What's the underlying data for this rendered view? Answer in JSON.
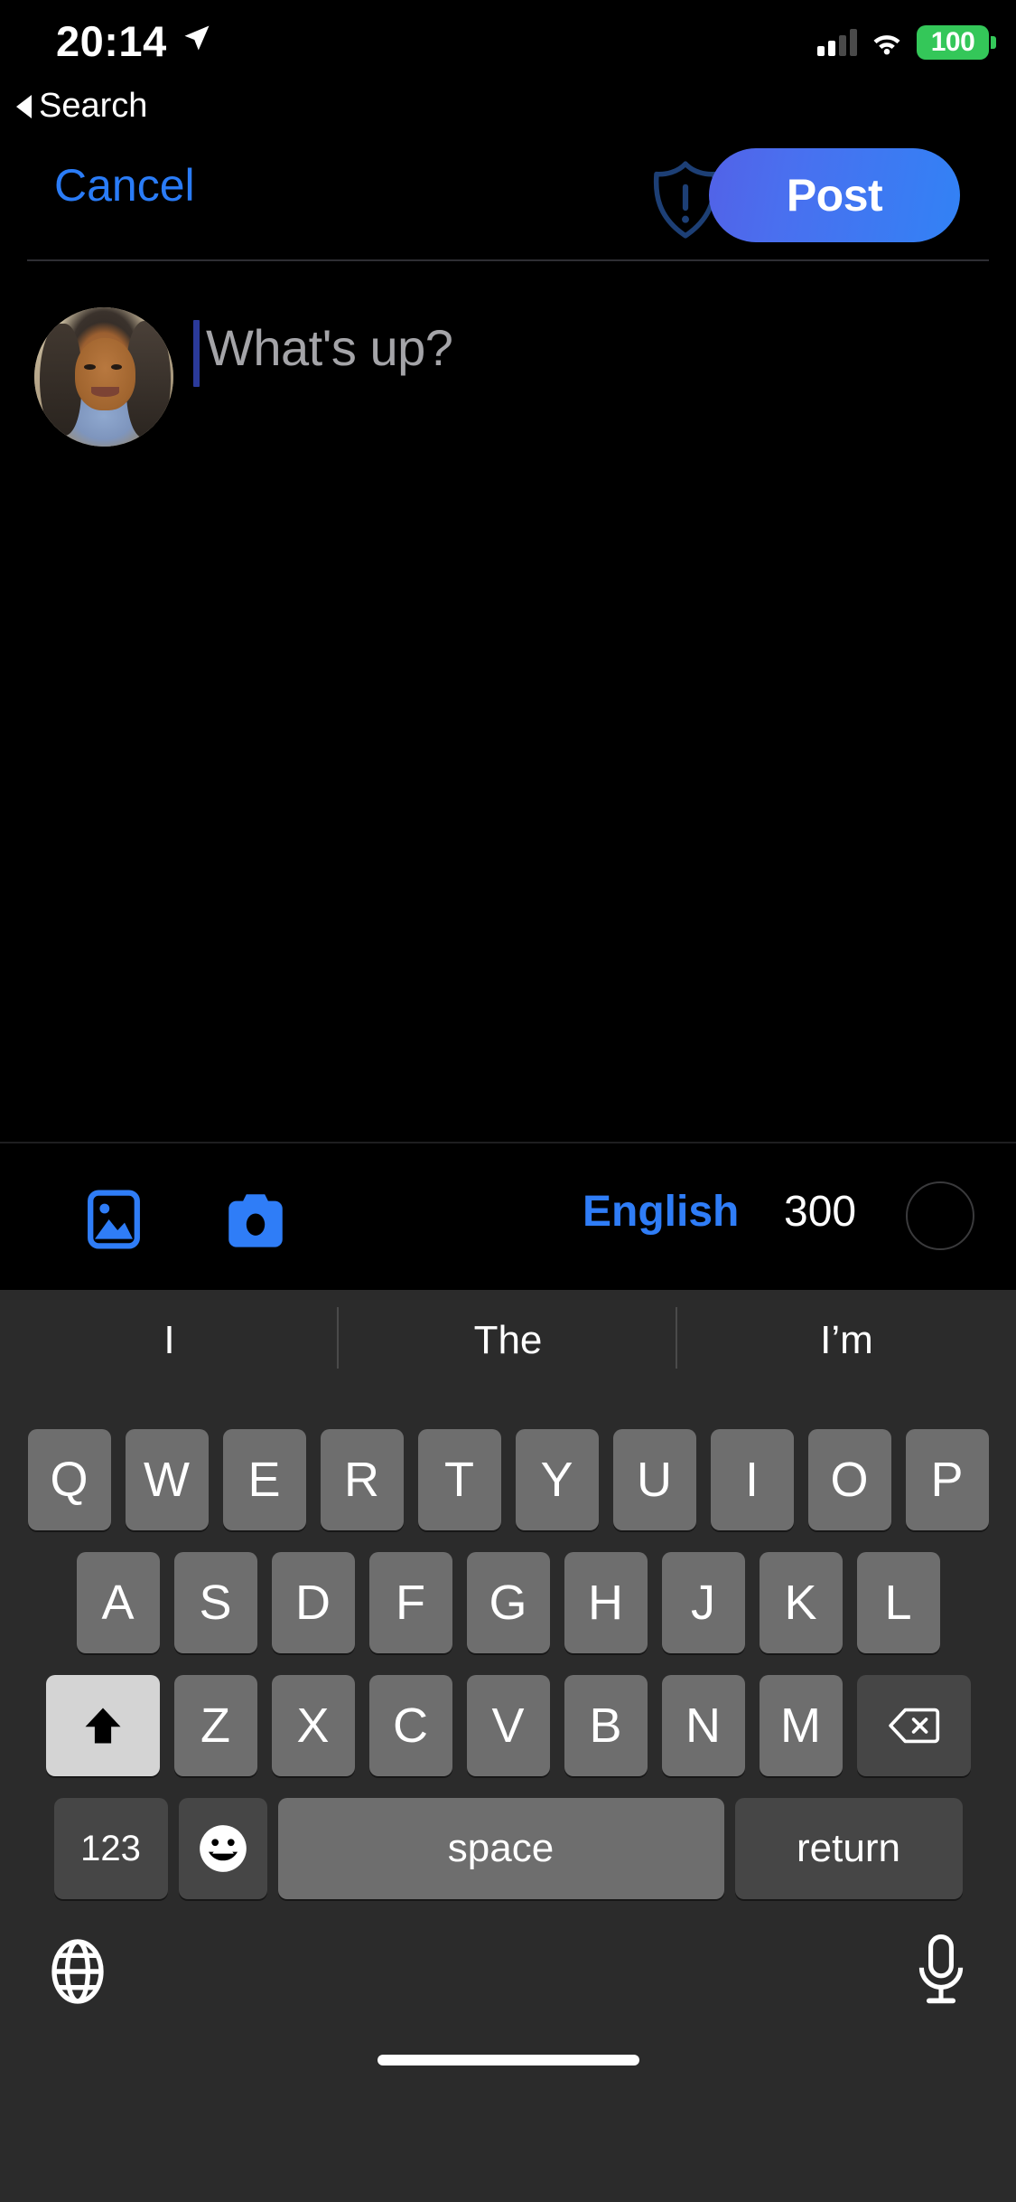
{
  "status_bar": {
    "time": "20:14",
    "location_icon": "location-arrow-icon",
    "signal_icon": "cellular-signal-icon",
    "wifi_icon": "wifi-icon",
    "battery_level": "100",
    "battery_color": "#34c759"
  },
  "back_to_app": {
    "label": "Search",
    "icon": "back-triangle-icon"
  },
  "nav": {
    "cancel_label": "Cancel",
    "shield_icon": "shield-exclamation-icon",
    "shield_color": "#1d3f75",
    "post_label": "Post",
    "post_gradient_start": "#5262e7",
    "post_gradient_end": "#3282f5",
    "cancel_color": "#2a7cf7"
  },
  "composer": {
    "avatar_icon": "user-avatar",
    "placeholder": "What's up?",
    "text_value": "",
    "caret_color": "#2b3a9a",
    "placeholder_color": "#a4a4a8"
  },
  "attach_toolbar": {
    "photo_icon": "photo-library-icon",
    "camera_icon": "camera-icon",
    "language_label": "English",
    "char_count": "300",
    "progress_ring_icon": "character-count-ring",
    "accent_color": "#2f7df7"
  },
  "keyboard": {
    "predictions": [
      "I",
      "The",
      "I’m"
    ],
    "row1": [
      "Q",
      "W",
      "E",
      "R",
      "T",
      "Y",
      "U",
      "I",
      "O",
      "P"
    ],
    "row2": [
      "A",
      "S",
      "D",
      "F",
      "G",
      "H",
      "J",
      "K",
      "L"
    ],
    "row3_letters": [
      "Z",
      "X",
      "C",
      "V",
      "B",
      "N",
      "M"
    ],
    "shift_icon": "shift-arrow-icon",
    "backspace_icon": "backspace-delete-icon",
    "numbers_label": "123",
    "emoji_icon": "emoji-smiley-icon",
    "space_label": "space",
    "return_label": "return",
    "globe_icon": "globe-language-icon",
    "mic_icon": "microphone-icon",
    "key_color": "#6e6e6e",
    "background_color": "#2b2b2b"
  }
}
